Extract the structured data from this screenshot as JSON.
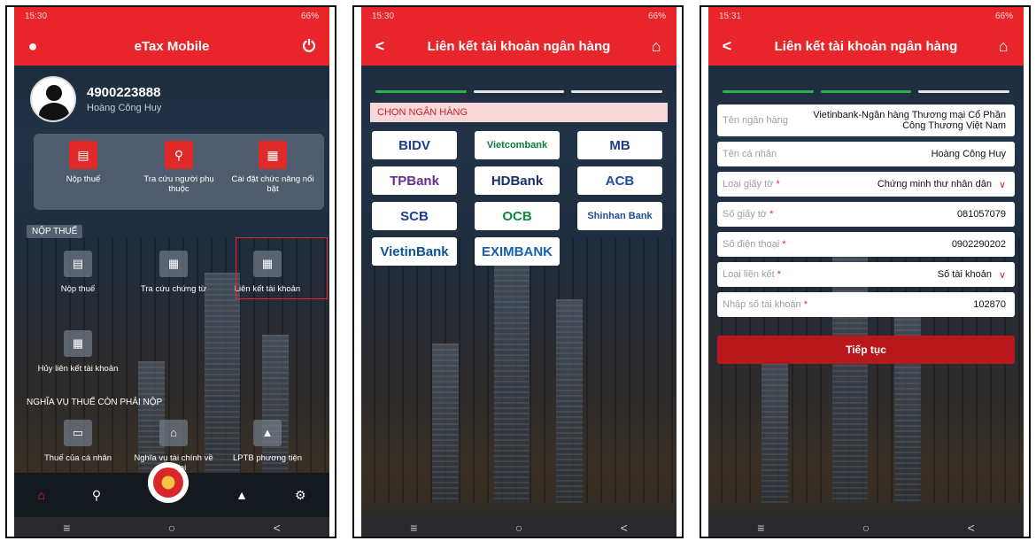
{
  "status": [
    {
      "time": "15:30",
      "right": "66%"
    },
    {
      "time": "15:30",
      "right": "66%"
    },
    {
      "time": "15:31",
      "right": "66%"
    }
  ],
  "panel1": {
    "title": "eTax Mobile",
    "user_icon": "user-icon",
    "power_icon": "power-icon",
    "tax_id": "4900223888",
    "user_name": "Hoàng Công Huy",
    "quick_items": [
      "Nộp thuế",
      "Tra cứu người phụ thuộc",
      "Cài đặt chức năng nổi bật"
    ],
    "section_pay": "NỘP THUẾ",
    "pay_items": [
      "Nộp thuế",
      "Tra cứu chứng từ",
      "Liên kết tài khoản",
      "Hủy liên kết tài khoản"
    ],
    "section_obligation": "NGHĨA VỤ THUẾ CÒN PHẢI NỘP",
    "obligation_items": [
      "Thuế của cá nhân",
      "Nghĩa vụ tài chính về đất đai",
      "LPTB phương tiện"
    ]
  },
  "panel2": {
    "title": "Liên kết tài khoản ngân hàng",
    "section": "CHỌN NGÂN HÀNG",
    "banks": [
      "BIDV",
      "Vietcombank",
      "MB",
      "TPBank",
      "HDBank",
      "ACB",
      "SCB",
      "OCB",
      "Shinhan Bank",
      "VietinBank",
      "EXIMBANK"
    ],
    "bank_colors": [
      "#1d3f91",
      "#0a7a3c",
      "#1e3a8a",
      "#6a2c91",
      "#1b2f6b",
      "#1f4fa2",
      "#1c3f95",
      "#0d8c3c",
      "#1b4e9b",
      "#0b5394",
      "#1560b0"
    ],
    "steps_done": 1,
    "steps_total": 3
  },
  "panel3": {
    "title": "Liên kết tài khoản ngân hàng",
    "steps_done": 2,
    "steps_total": 3,
    "fields": [
      {
        "label": "Tên ngân hàng",
        "required": false,
        "value": "Vietinbank-Ngân hàng Thương mại Cổ Phần Công Thương Việt Nam",
        "dropdown": false
      },
      {
        "label": "Tên cá nhân",
        "required": false,
        "value": "Hoàng Công Huy",
        "dropdown": false
      },
      {
        "label": "Loại giấy tờ",
        "required": true,
        "value": "Chứng minh thư nhân dân",
        "dropdown": true
      },
      {
        "label": "Số giấy tờ",
        "required": true,
        "value": "081057079",
        "dropdown": false
      },
      {
        "label": "Số điện thoại",
        "required": true,
        "value": "0902290202",
        "dropdown": false
      },
      {
        "label": "Loại liên kết",
        "required": true,
        "value": "Số tài khoản",
        "dropdown": true
      },
      {
        "label": "Nhập số tài khoản",
        "required": true,
        "value": "102870",
        "dropdown": false
      }
    ],
    "continue_label": "Tiếp tục"
  },
  "colors": {
    "accent": "#e8252a",
    "step_done": "#2bb24c",
    "section_bg": "#f8d7d8"
  }
}
